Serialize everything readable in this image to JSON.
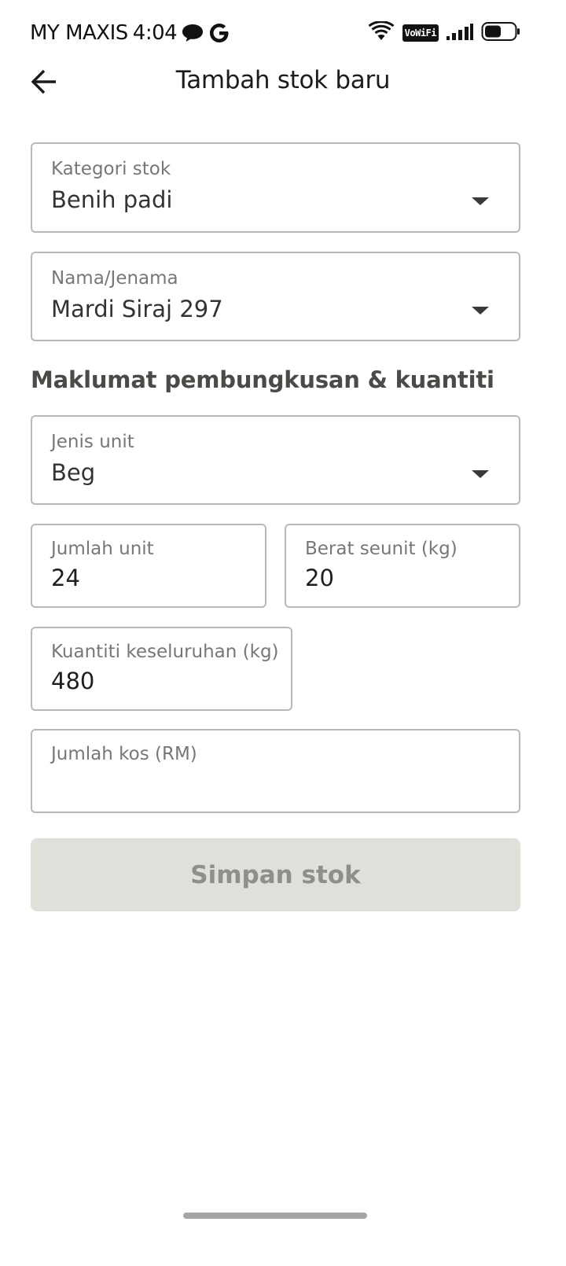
{
  "status_bar": {
    "carrier": "MY MAXIS",
    "time": "4:04",
    "vowifi": "VoWiFi",
    "icons": [
      "message-icon",
      "google-icon",
      "wifi-icon",
      "signal-icon",
      "battery-icon"
    ]
  },
  "header": {
    "title": "Tambah stok baru",
    "back_icon": "arrow-left-icon"
  },
  "form": {
    "category": {
      "label": "Kategori stok",
      "value": "Benih padi"
    },
    "brand": {
      "label": "Nama/Jenama",
      "value": "Mardi Siraj 297"
    },
    "section_heading": "Maklumat pembungkusan & kuantiti",
    "unit_type": {
      "label": "Jenis unit",
      "value": "Beg"
    },
    "unit_count": {
      "label": "Jumlah unit",
      "value": "24"
    },
    "unit_weight": {
      "label": "Berat seunit (kg)",
      "value": "20"
    },
    "total_quantity": {
      "label": "Kuantiti keseluruhan (kg)",
      "value": "480"
    },
    "total_cost": {
      "label": "Jumlah kos (RM)",
      "value": ""
    }
  },
  "actions": {
    "save_label": "Simpan stok"
  },
  "colors": {
    "border": "#b8b8b6",
    "button_disabled_bg": "#e0e0da",
    "button_disabled_text": "#8f8f8a",
    "section_heading": "#4a4a47"
  }
}
